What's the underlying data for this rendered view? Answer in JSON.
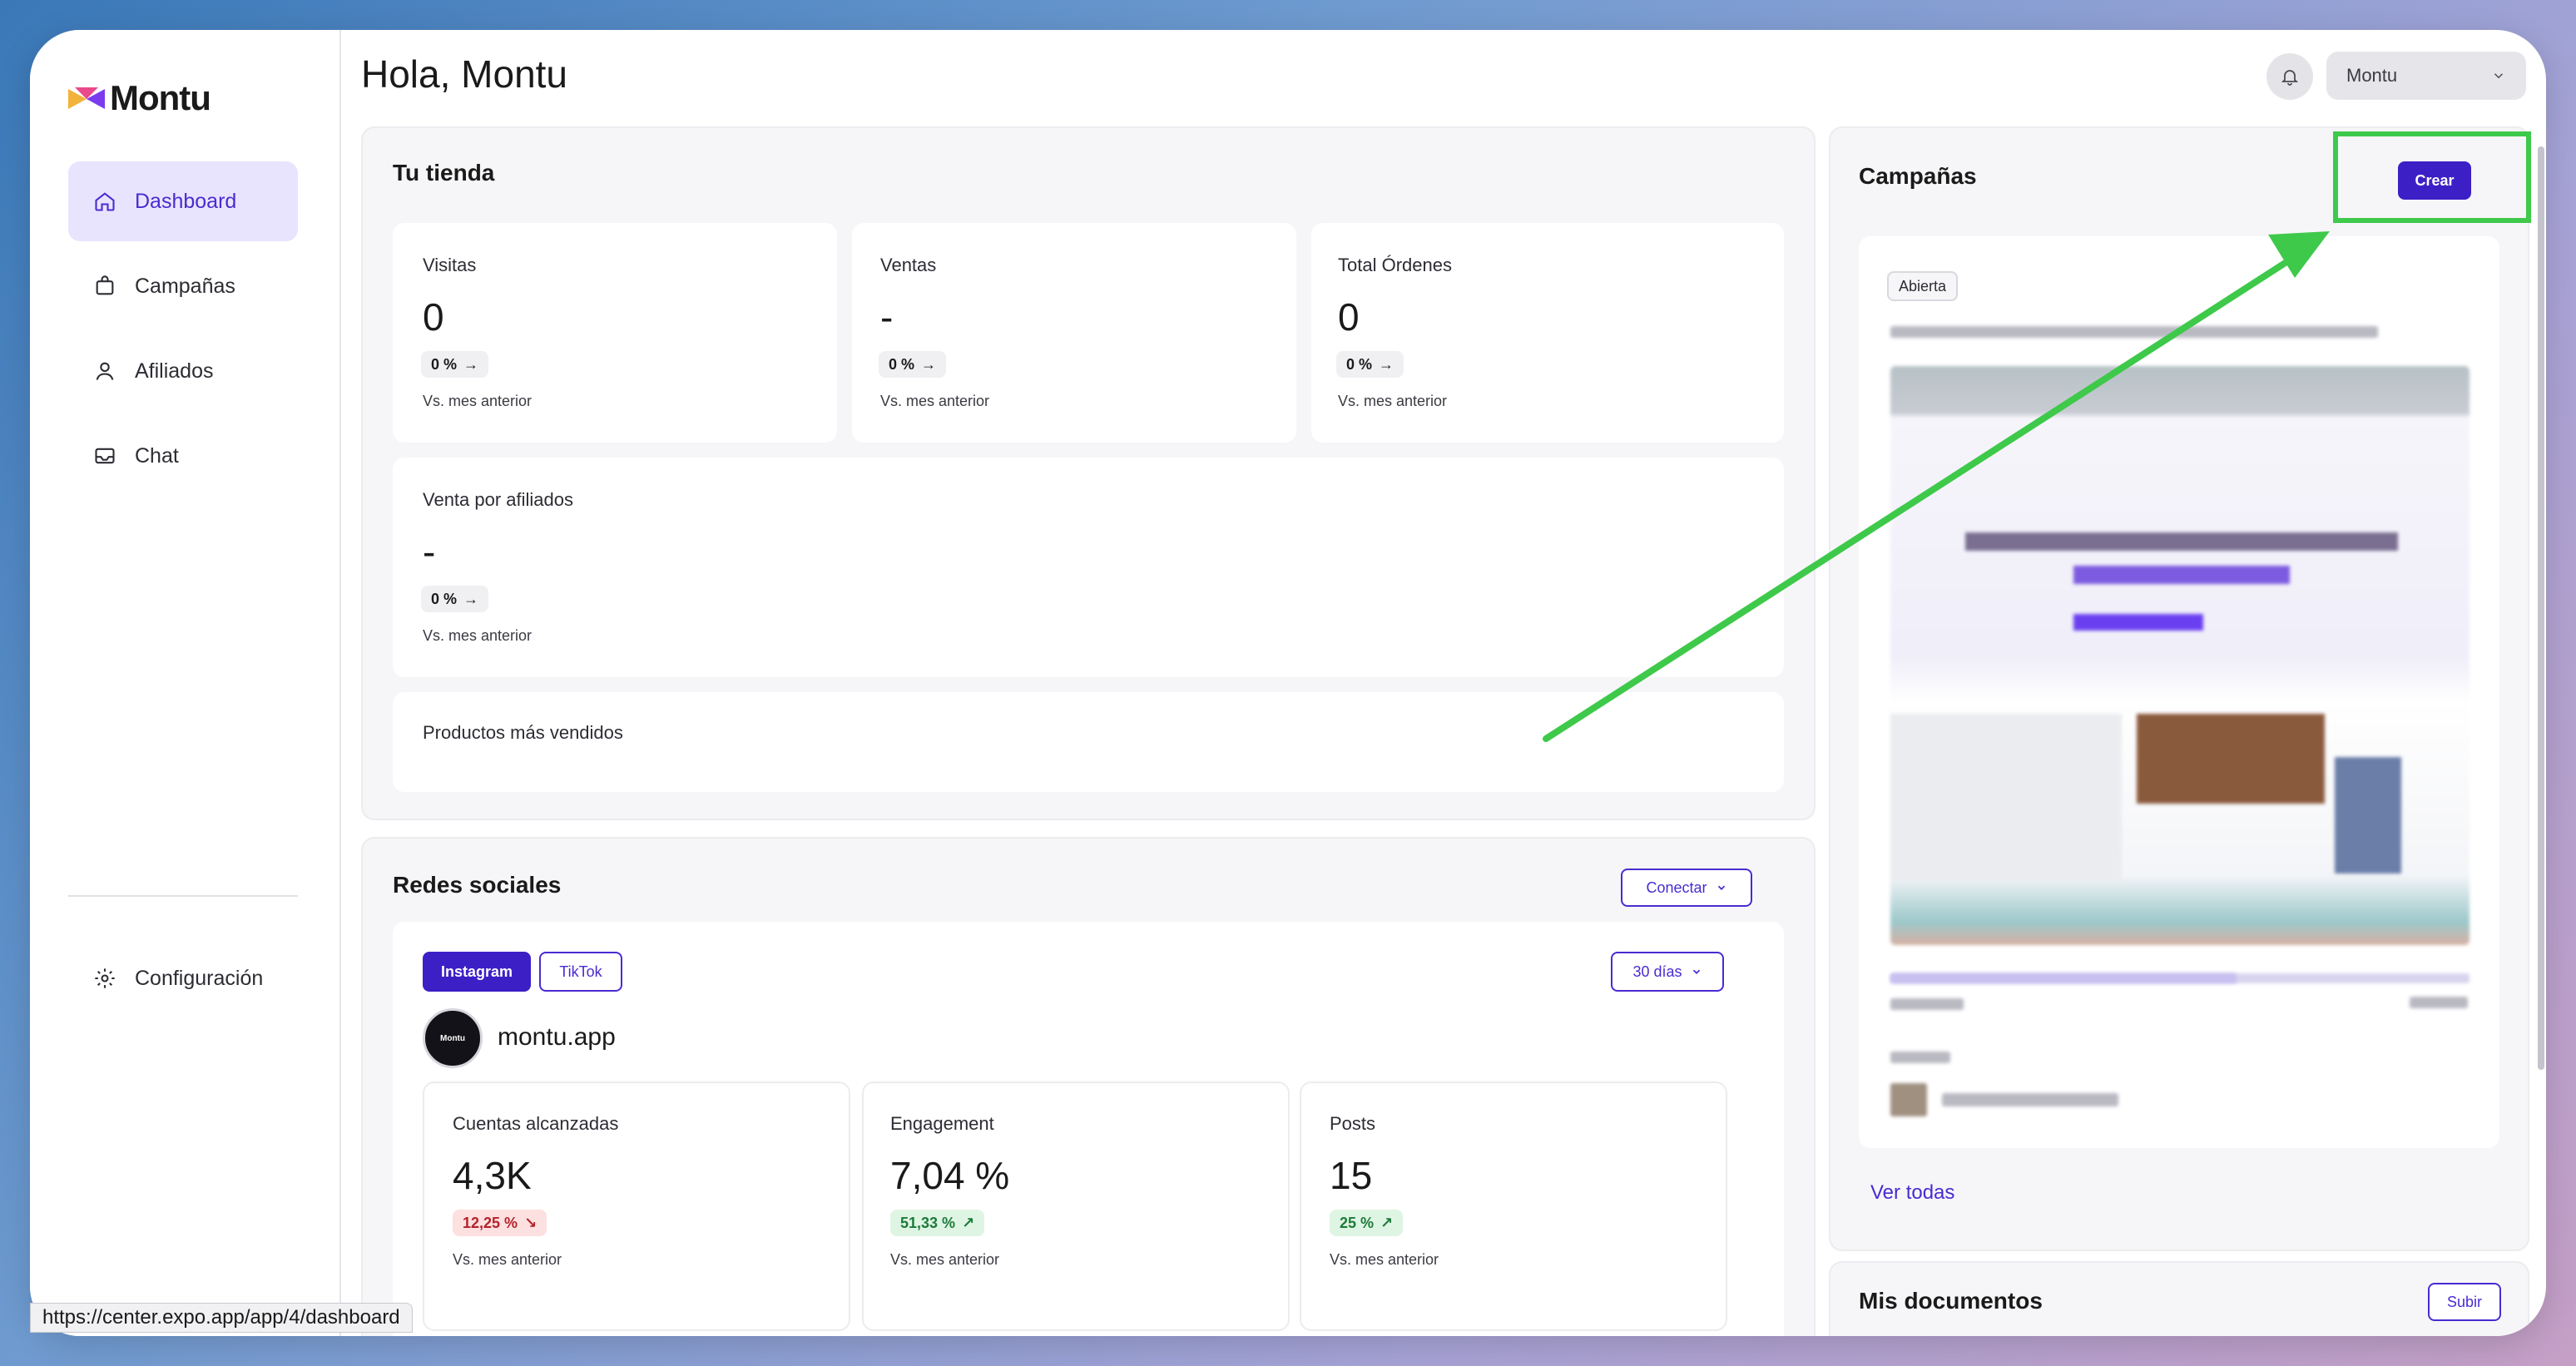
{
  "header": {
    "greeting": "Hola, Montu",
    "user_name": "Montu"
  },
  "sidebar": {
    "logo": "Montu",
    "items": [
      {
        "label": "Dashboard",
        "icon": "home-icon",
        "active": true
      },
      {
        "label": "Campañas",
        "icon": "bag-icon",
        "active": false
      },
      {
        "label": "Afiliados",
        "icon": "user-icon",
        "active": false
      },
      {
        "label": "Chat",
        "icon": "inbox-icon",
        "active": false
      }
    ],
    "config_label": "Configuración"
  },
  "tienda": {
    "title": "Tu tienda",
    "stats": [
      {
        "label": "Visitas",
        "value": "0",
        "change": "0 %",
        "compare": "Vs. mes anterior"
      },
      {
        "label": "Ventas",
        "value": "-",
        "change": "0 %",
        "compare": "Vs. mes anterior"
      },
      {
        "label": "Total Órdenes",
        "value": "0",
        "change": "0 %",
        "compare": "Vs. mes anterior"
      }
    ],
    "afiliados": {
      "label": "Venta por afiliados",
      "value": "-",
      "change": "0 %",
      "compare": "Vs. mes anterior"
    },
    "productos_label": "Productos más vendidos"
  },
  "redes": {
    "title": "Redes sociales",
    "connect_label": "Conectar",
    "tabs": [
      {
        "label": "Instagram",
        "active": true
      },
      {
        "label": "TikTok",
        "active": false
      }
    ],
    "range_label": "30 días",
    "avatar_text": "Montu",
    "account": "montu.app",
    "stats": [
      {
        "label": "Cuentas alcanzadas",
        "value": "4,3K",
        "change": "12,25 %",
        "trend": "down",
        "compare": "Vs. mes anterior"
      },
      {
        "label": "Engagement",
        "value": "7,04 %",
        "change": "51,33 %",
        "trend": "up",
        "compare": "Vs. mes anterior"
      },
      {
        "label": "Posts",
        "value": "15",
        "change": "25 %",
        "trend": "up",
        "compare": "Vs. mes anterior"
      }
    ]
  },
  "campanas": {
    "title": "Campañas",
    "create_label": "Crear",
    "status_badge": "Abierta",
    "view_all": "Ver todas"
  },
  "documentos": {
    "title": "Mis documentos",
    "upload_label": "Subir"
  },
  "status_bar_url": "https://center.expo.app/app/4/dashboard",
  "colors": {
    "accent": "#3d1fc6",
    "annotation": "#3ec94a",
    "active_nav_bg": "#e9e4fd"
  }
}
